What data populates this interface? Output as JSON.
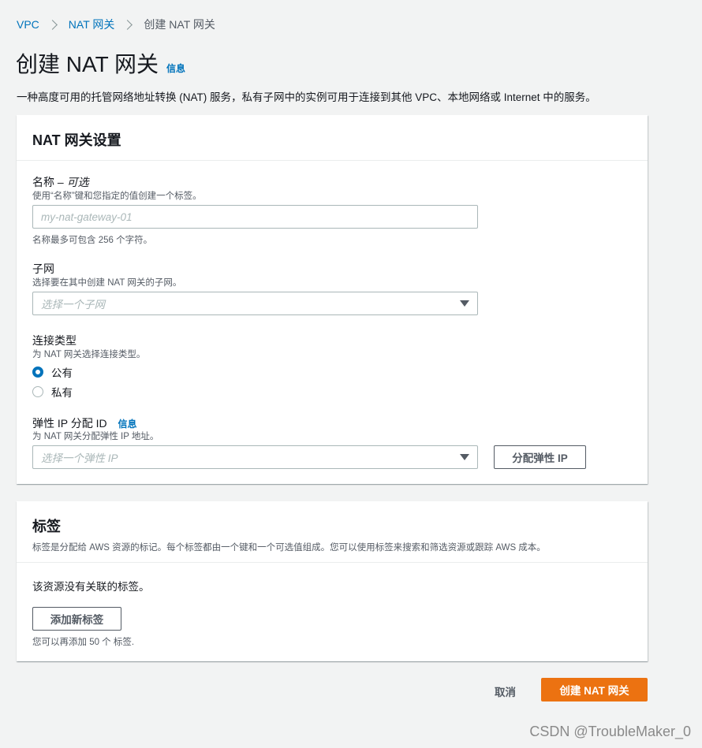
{
  "breadcrumb": {
    "items": [
      "VPC",
      "NAT 网关"
    ],
    "current": "创建 NAT 网关"
  },
  "page": {
    "title": "创建 NAT 网关",
    "info": "信息",
    "description": "一种高度可用的托管网络地址转换 (NAT) 服务，私有子网中的实例可用于连接到其他 VPC、本地网络或 Internet 中的服务。"
  },
  "settings": {
    "title": "NAT 网关设置",
    "name": {
      "label": "名称 – ",
      "label_optional": "可选",
      "description": "使用“名称”键和您指定的值创建一个标签。",
      "placeholder": "my-nat-gateway-01",
      "value": "",
      "constraint": "名称最多可包含 256 个字符。"
    },
    "subnet": {
      "label": "子网",
      "description": "选择要在其中创建 NAT 网关的子网。",
      "placeholder": "选择一个子网"
    },
    "connectivity": {
      "label": "连接类型",
      "description": "为 NAT 网关选择连接类型。",
      "options": [
        "公有",
        "私有"
      ],
      "selected": "公有"
    },
    "eip": {
      "label": "弹性 IP 分配 ID",
      "info": "信息",
      "description": "为 NAT 网关分配弹性 IP 地址。",
      "placeholder": "选择一个弹性 IP",
      "allocate_button": "分配弹性 IP"
    }
  },
  "tags": {
    "title": "标签",
    "description": "标签是分配给 AWS 资源的标记。每个标签都由一个键和一个可选值组成。您可以使用标签来搜索和筛选资源或跟踪 AWS 成本。",
    "empty": "该资源没有关联的标签。",
    "add_button": "添加新标签",
    "remaining": "您可以再添加 50 个 标签."
  },
  "footer": {
    "cancel": "取消",
    "submit": "创建 NAT 网关"
  },
  "watermark": "CSDN @TroubleMaker_0",
  "colors": {
    "link": "#0073bb",
    "primary": "#ec7211",
    "background": "#f2f3f3"
  }
}
